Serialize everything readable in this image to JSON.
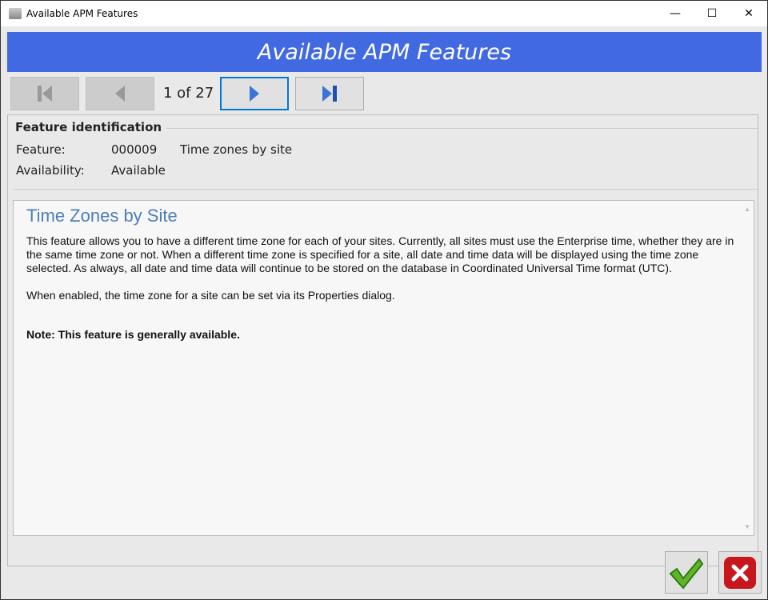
{
  "window": {
    "title": "Available APM Features",
    "minimize": "—",
    "maximize": "☐",
    "close": "✕"
  },
  "banner": {
    "title": "Available APM Features"
  },
  "nav": {
    "pager": "1 of 27"
  },
  "identification": {
    "legend": "Feature identification",
    "feature_label": "Feature:",
    "feature_id": "000009",
    "feature_name": "Time zones by site",
    "availability_label": "Availability:",
    "availability_value": "Available"
  },
  "doc": {
    "heading": "Time Zones by Site",
    "para1": "This feature allows you to have a different time zone for each of your sites.  Currently, all sites must use the Enterprise time, whether they are in the same time zone or not.  When a different time zone is specified for a site, all date and time data will be displayed using the time zone selected.  As always, all date and time data will continue to be stored on the database in Coordinated Universal Time format (UTC).",
    "para2": "When enabled, the time zone for a site can be set via its Properties dialog.",
    "note": "Note:  This feature is generally available."
  }
}
